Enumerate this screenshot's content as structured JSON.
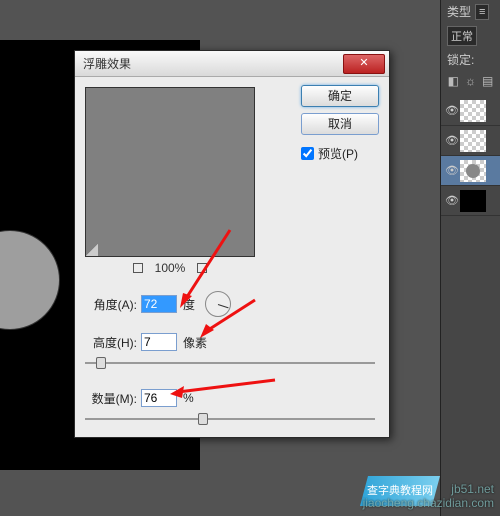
{
  "app": {
    "title_bar": ""
  },
  "right_panel": {
    "kind_label": "类型",
    "blend_label": "正常",
    "lock_label": "锁定:"
  },
  "dialog": {
    "title": "浮雕效果",
    "ok_label": "确定",
    "cancel_label": "取消",
    "preview_label": "预览(P)",
    "zoom": "100%",
    "angle": {
      "label": "角度(A):",
      "value": "72",
      "unit": "度"
    },
    "height": {
      "label": "高度(H):",
      "value": "7",
      "unit": "像素"
    },
    "amount": {
      "label": "数量(M):",
      "value": "76",
      "unit": "%"
    }
  },
  "watermark": {
    "site1": "jb51.net",
    "site2": "jiaocheng.chazidian.com",
    "badge": "查字典教程网"
  }
}
